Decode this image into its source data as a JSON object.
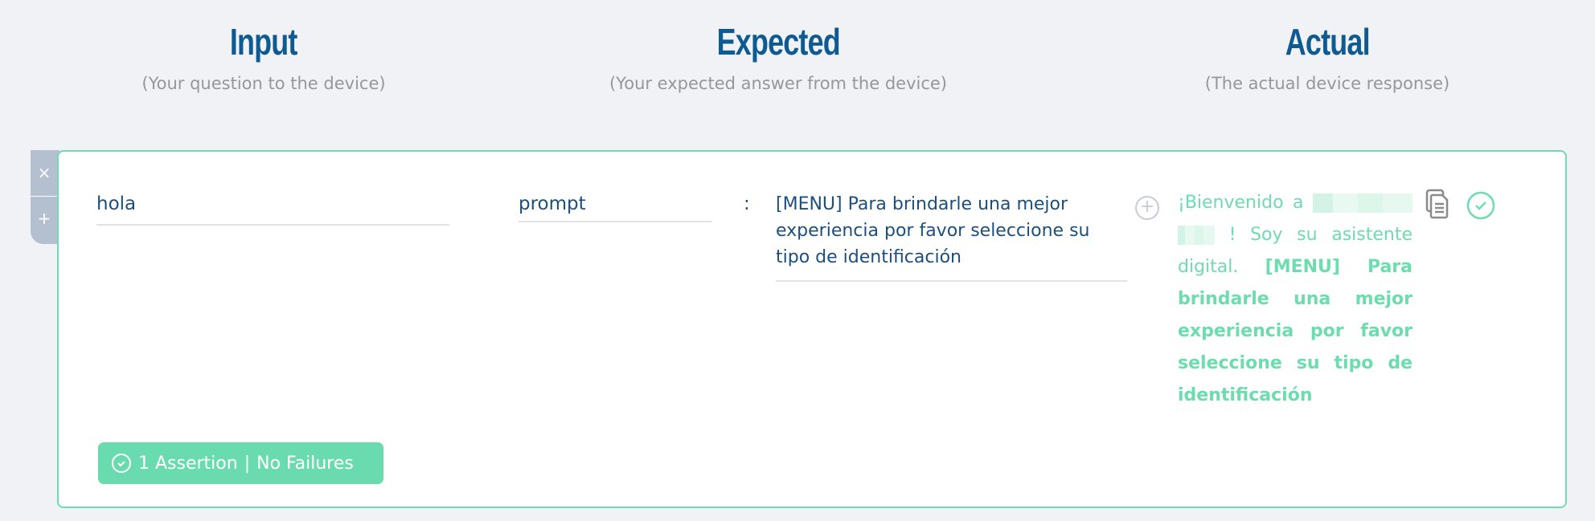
{
  "columns": [
    {
      "title": "Input",
      "subtitle": "(Your question to the device)"
    },
    {
      "title": "Expected",
      "subtitle": "(Your expected answer from the device)"
    },
    {
      "title": "Actual",
      "subtitle": "(The actual device response)"
    }
  ],
  "side_tab": {
    "remove_label": "×",
    "add_label": "+"
  },
  "row": {
    "input": "hola",
    "expected_type": "prompt",
    "separator": ":",
    "expected_text": "[MENU] Para brindarle una mejor experiencia por favor seleccione su tipo de identificación",
    "actual": {
      "prefix": "¡Bienvenido a",
      "middle": "! Soy su asistente digital.",
      "match": "[MENU] Para brindarle una mejor experiencia por favor seleccione su tipo de identificación"
    },
    "status": {
      "assertions": "1 Assertion",
      "separator": "|",
      "result": "No Failures"
    }
  },
  "colors": {
    "heading": "#0e5a91",
    "accent_green": "#6ddcae",
    "text_blue": "#1c4f7e",
    "muted": "#959799"
  }
}
